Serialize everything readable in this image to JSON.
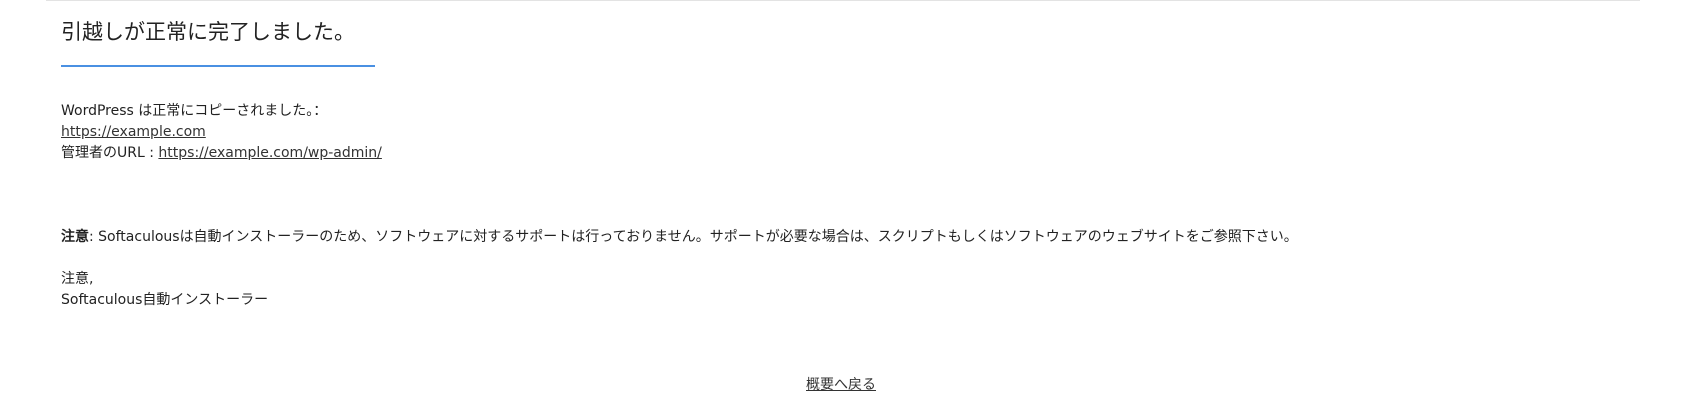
{
  "title": "引越しが正常に完了しました。",
  "info": {
    "copied_text": "WordPress は正常にコピーされました。：",
    "site_url": "https://example.com",
    "admin_label": "管理者のURL : ",
    "admin_url": "https://example.com/wp-admin/"
  },
  "notice": {
    "label": "注意",
    "text": ": Softaculousは自動インストーラーのため、ソフトウェアに対するサポートは行っておりません。サポートが必要な場合は、スクリプトもしくはソフトウェアのウェブサイトをご参照下さい。"
  },
  "signoff": {
    "line1": "注意,",
    "line2": "Softaculous自動インストーラー"
  },
  "footer": {
    "back_link": "概要へ戻る"
  },
  "colors": {
    "accent": "#4a90e2",
    "text": "#222222"
  }
}
